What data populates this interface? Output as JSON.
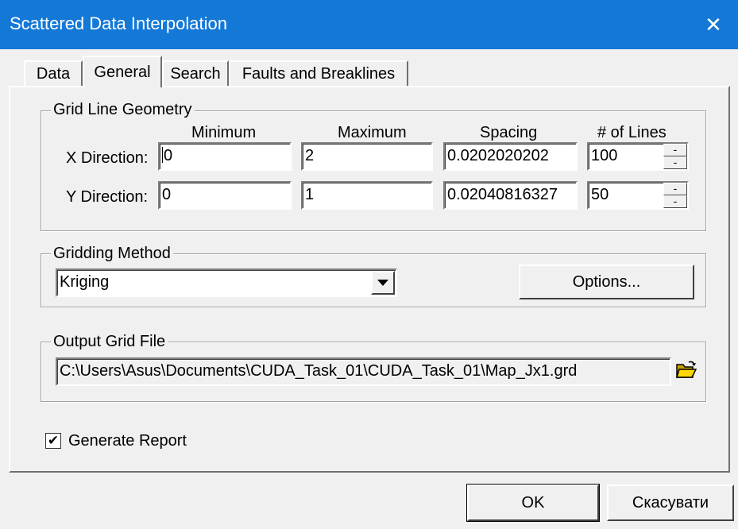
{
  "window": {
    "title": "Scattered Data Interpolation",
    "close_glyph": "✕"
  },
  "tabs": [
    {
      "label": "Data",
      "active": false
    },
    {
      "label": "General",
      "active": true
    },
    {
      "label": "Search",
      "active": false
    },
    {
      "label": "Faults and Breaklines",
      "active": false
    }
  ],
  "grid_geometry": {
    "group_label": "Grid Line Geometry",
    "columns": {
      "minimum": "Minimum",
      "maximum": "Maximum",
      "spacing": "Spacing",
      "lines": "# of Lines"
    },
    "x": {
      "label": "X Direction:",
      "minimum": "0",
      "maximum": "2",
      "spacing": "0.0202020202",
      "lines": "100"
    },
    "y": {
      "label": "Y Direction:",
      "minimum": "0",
      "maximum": "1",
      "spacing": "0.02040816327",
      "lines": "50"
    }
  },
  "gridding": {
    "group_label": "Gridding Method",
    "method": "Kriging",
    "options_label": "Options..."
  },
  "output": {
    "group_label": "Output Grid File",
    "path": "C:\\Users\\Asus\\Documents\\CUDA_Task_01\\CUDA_Task_01\\Map_Jx1.grd",
    "browse_icon": "open-folder-icon"
  },
  "report": {
    "label": "Generate Report",
    "checked": true
  },
  "buttons": {
    "ok": "OK",
    "cancel": "Скасувати"
  }
}
